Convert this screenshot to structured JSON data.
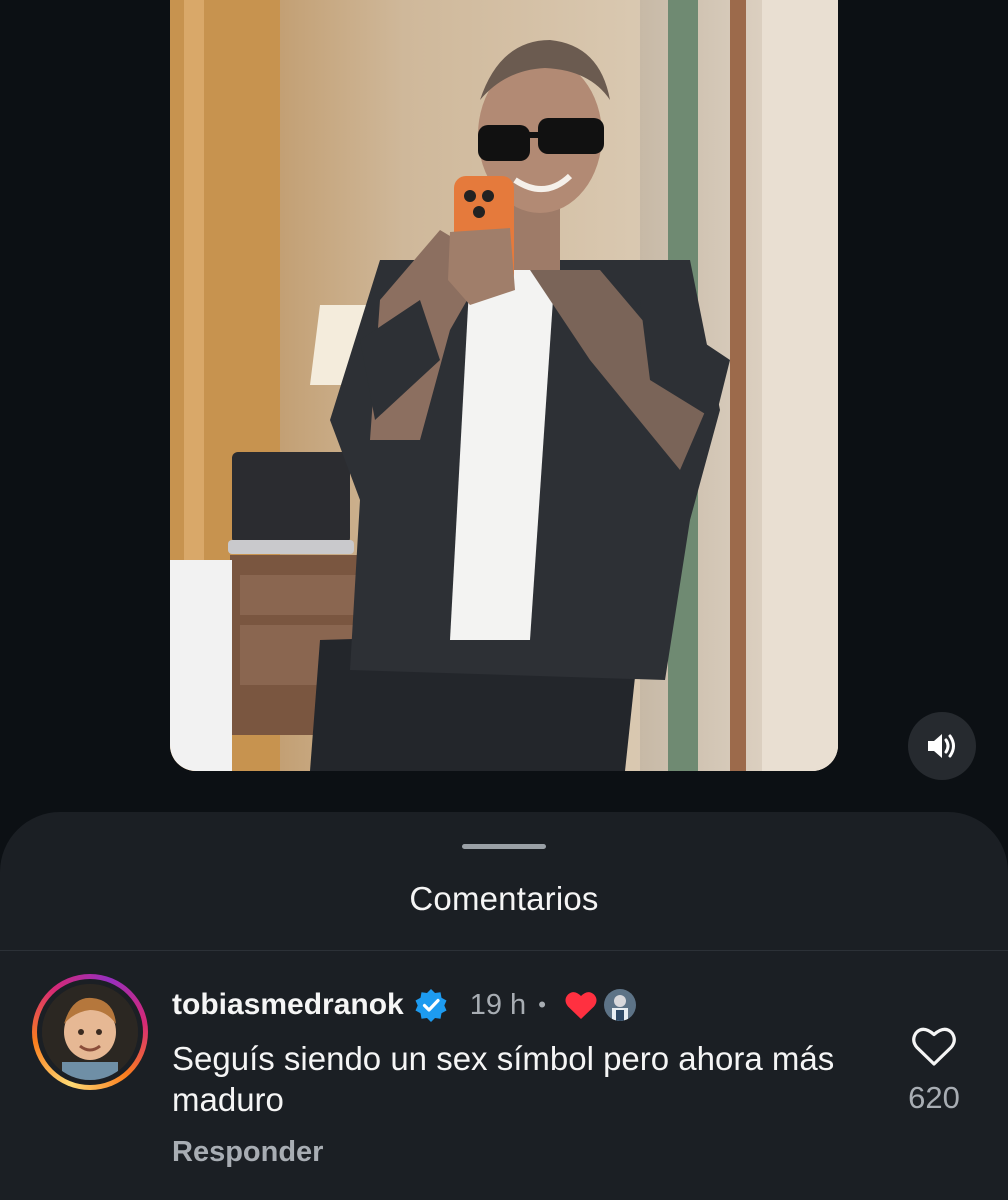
{
  "colors": {
    "background": "#0c1014",
    "sheet_background": "#1b1f24",
    "verified_blue": "#1d9bf0",
    "like_red": "#ff3040",
    "secondary_text": "#a8adb3"
  },
  "media": {
    "mute_icon": "speaker-volume-icon"
  },
  "comments_sheet": {
    "title": "Comentarios",
    "comments": [
      {
        "username": "tobiasmedranok",
        "verified": true,
        "time": "19 h",
        "separator": "•",
        "liked_by_author": true,
        "text": "Seguís siendo un sex símbol pero ahora más maduro",
        "reply_label": "Responder",
        "like_count": "620"
      }
    ]
  }
}
